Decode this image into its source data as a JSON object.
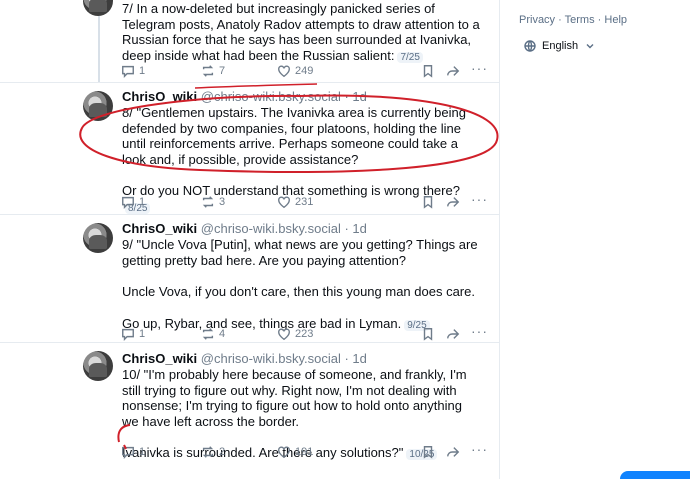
{
  "posts": [
    {
      "body_lines": [
        "7/ In a now-deleted but increasingly panicked series of Telegram posts, Anatoly Radov attempts to draw attention to a Russian force that he says has been surrounded at Ivanivka, deep inside what had been the Russian salient:"
      ],
      "counter": "7/25",
      "replies": "1",
      "reposts": "7",
      "likes": "249"
    },
    {
      "name": "ChrisO_wiki",
      "handle": "@chriso-wiki.bsky.social",
      "time": "· 1d",
      "body_main": "8/ \"Gentlemen upstairs. The Ivanivka area is currently being defended by two companies, four platoons, holding the line until reinforcements arrive. Perhaps someone could take a look and, if possible, provide assistance?",
      "body_tail": "Or do you NOT understand that something is wrong there?",
      "counter": "8/25",
      "replies": "1",
      "reposts": "3",
      "likes": "231"
    },
    {
      "name": "ChrisO_wiki",
      "handle": "@chriso-wiki.bsky.social",
      "time": "· 1d",
      "p1": "9/ \"Uncle Vova [Putin], what news are you getting? Things are getting pretty bad here. Are you paying attention?",
      "p2": "Uncle Vova, if you don't care, then this young man does care.",
      "p3": "Go up, Rybar, and see, things are bad in Lyman.",
      "counter": "9/25",
      "replies": "1",
      "reposts": "4",
      "likes": "223"
    },
    {
      "name": "ChrisO_wiki",
      "handle": "@chriso-wiki.bsky.social",
      "time": "· 1d",
      "p1": "10/ \"I'm probably here because of someone, and frankly, I'm still trying to figure out why. Right now, I'm not dealing with nonsense; I'm trying to figure out how to hold onto anything we have left across the border.",
      "p2": "Ivanivka is surrounded. Are there any solutions?\"",
      "counter": "10/25",
      "replies": "1",
      "reposts": "2",
      "likes": "191"
    }
  ],
  "sidebar": {
    "privacy": "Privacy",
    "sep": "·",
    "terms": "Terms",
    "help": "Help",
    "language": "English"
  },
  "more_glyph": "···",
  "accent": "#1083fe",
  "annotation_color": "#d0202a"
}
